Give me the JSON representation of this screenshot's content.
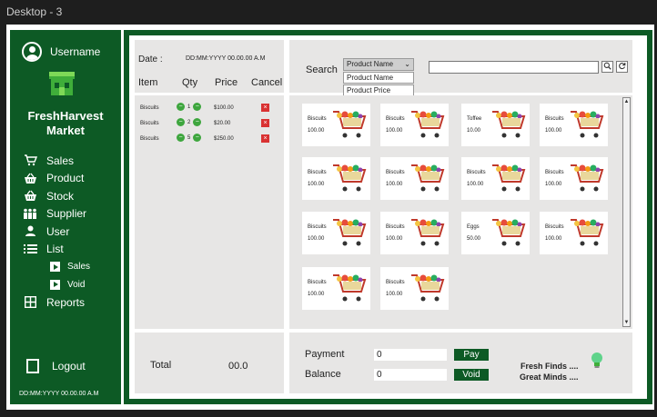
{
  "frame": {
    "title": "Desktop - 3"
  },
  "sidebar": {
    "username": "Username",
    "store_name_line1": "FreshHarvest",
    "store_name_line2": "Market",
    "items": [
      {
        "label": "Sales",
        "icon": "cart-icon"
      },
      {
        "label": "Product",
        "icon": "basket-icon"
      },
      {
        "label": "Stock",
        "icon": "basket-icon"
      },
      {
        "label": "Supplier",
        "icon": "people-icon"
      },
      {
        "label": "User",
        "icon": "user-icon"
      },
      {
        "label": "List",
        "icon": "list-icon"
      }
    ],
    "subitems": [
      {
        "label": "Sales",
        "icon": "play-icon"
      },
      {
        "label": "Void",
        "icon": "play-icon"
      }
    ],
    "reports": {
      "label": "Reports",
      "icon": "grid-icon"
    },
    "logout": "Logout",
    "datetime": "DD:MM:YYYY   00.00.00   A.M"
  },
  "order": {
    "date_label": "Date :",
    "date_value": "DD:MM:YYYY    00.00.00    A.M",
    "columns": [
      "Item",
      "Qty",
      "Price",
      "Cancel"
    ],
    "rows": [
      {
        "item": "Biscuits",
        "qty": "1",
        "price": "$100.00"
      },
      {
        "item": "Biscuits",
        "qty": "2",
        "price": "$20.00"
      },
      {
        "item": "Biscuits",
        "qty": "5",
        "price": "$250.00"
      }
    ]
  },
  "search": {
    "label": "Search",
    "selected": "Product Name",
    "options": [
      "Product Name",
      "Product Price"
    ],
    "query": ""
  },
  "products": [
    {
      "name": "Biscuits",
      "price": "100.00"
    },
    {
      "name": "Biscuits",
      "price": "100.00"
    },
    {
      "name": "Toffee",
      "price": "10.00"
    },
    {
      "name": "Biscuits",
      "price": "100.00"
    },
    {
      "name": "Biscuits",
      "price": "100.00"
    },
    {
      "name": "Biscuits",
      "price": "100.00"
    },
    {
      "name": "Biscuits",
      "price": "100.00"
    },
    {
      "name": "Biscuits",
      "price": "100.00"
    },
    {
      "name": "Biscuits",
      "price": "100.00"
    },
    {
      "name": "Biscuits",
      "price": "100.00"
    },
    {
      "name": "Eggs",
      "price": "50.00"
    },
    {
      "name": "Biscuits",
      "price": "100.00"
    },
    {
      "name": "Biscuits",
      "price": "100.00"
    },
    {
      "name": "Biscuits",
      "price": "100.00"
    }
  ],
  "totals": {
    "label": "Total",
    "value": "00.0"
  },
  "payment": {
    "payment_label": "Payment",
    "payment_value": "0",
    "balance_label": "Balance",
    "balance_value": "0",
    "pay_button": "Pay",
    "void_button": "Void"
  },
  "slogan": {
    "line1": "Fresh Finds ....",
    "line2": "Great Minds ...."
  },
  "colors": {
    "primary": "#0d5a25",
    "panel": "#e7e6e5",
    "cancel": "#d93232",
    "qty": "#3ea63e"
  }
}
